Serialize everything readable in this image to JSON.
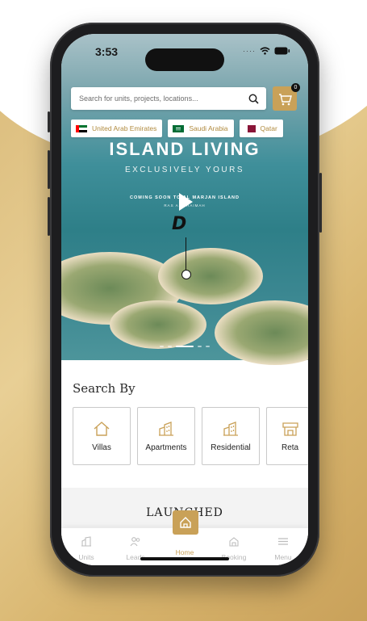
{
  "status_bar": {
    "time": "3:53"
  },
  "search": {
    "placeholder": "Search for units, projects, locations..."
  },
  "cart": {
    "badge_count": "0"
  },
  "countries": [
    {
      "label": "United Arab Emirates",
      "flag": "uae-flag"
    },
    {
      "label": "Saudi Arabia",
      "flag": "saudi-flag"
    },
    {
      "label": "Qatar",
      "flag": "qatar-flag"
    }
  ],
  "hero": {
    "title": "ISLAND LIVING",
    "subtitle": "EXCLUSIVELY YOURS",
    "coming_soon": "COMING SOON TO AL MARJAN ISLAND",
    "location": "RAS AL KHAIMAH",
    "slides_total": 5,
    "slide_active": 3
  },
  "search_by": {
    "title": "Search By",
    "categories": [
      {
        "label": "Villas",
        "icon": "house-icon"
      },
      {
        "label": "Apartments",
        "icon": "buildings-icon"
      },
      {
        "label": "Residential",
        "icon": "buildings-icon"
      },
      {
        "label": "Reta",
        "icon": "store-icon"
      }
    ]
  },
  "launched": {
    "title": "LAUNCHED"
  },
  "bottom_nav": {
    "items": [
      {
        "label": "Units",
        "icon": "units-icon"
      },
      {
        "label": "Leads",
        "icon": "leads-icon"
      },
      {
        "label": "Home",
        "icon": "home-icon"
      },
      {
        "label": "Booking",
        "icon": "booking-icon"
      },
      {
        "label": "Menu",
        "icon": "menu-icon"
      }
    ],
    "active": "Home"
  },
  "colors": {
    "accent": "#c9a158",
    "accent_text": "#b08a3e",
    "page_bg": "#e3c88f"
  }
}
